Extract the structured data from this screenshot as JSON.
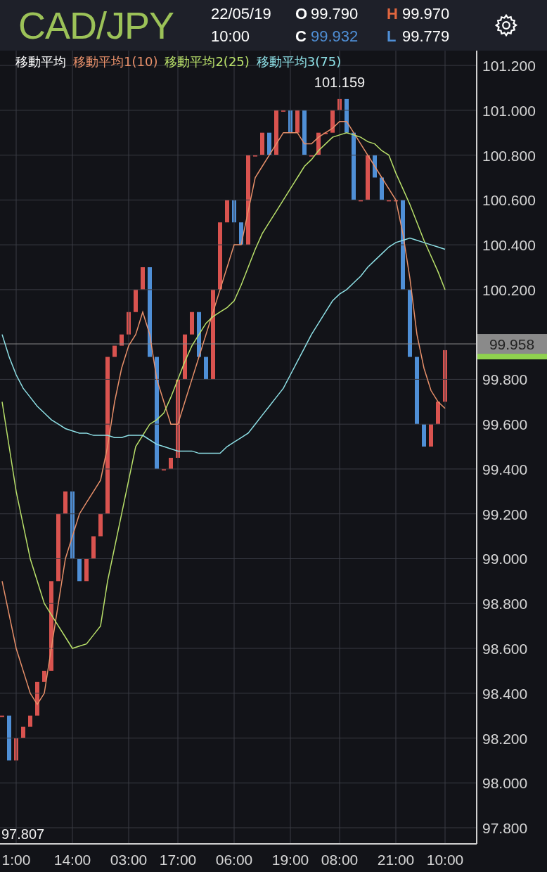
{
  "header": {
    "symbol": "CAD/JPY",
    "date": "22/05/19",
    "time": "10:00",
    "ohlc": [
      {
        "label": {
          "text": "O",
          "color": "#ffffff"
        },
        "value": {
          "text": "99.790",
          "color": "#ffffff"
        }
      },
      {
        "label": {
          "text": "H",
          "color": "#e0663f"
        },
        "value": {
          "text": "99.970",
          "color": "#ffffff"
        }
      },
      {
        "label": {
          "text": "C",
          "color": "#ffffff"
        },
        "value": {
          "text": "99.932",
          "color": "#4f8fd6"
        }
      },
      {
        "label": {
          "text": "L",
          "color": "#4f8fd6"
        },
        "value": {
          "text": "99.779",
          "color": "#ffffff"
        }
      }
    ]
  },
  "legend": {
    "title": "移動平均"
  },
  "chart": {
    "chart_data": {
      "type": "line",
      "grid": true,
      "ref_lines": [
        {
          "axis": "y",
          "value": 99.958,
          "label": "99.958"
        }
      ],
      "categories": [
        null,
        null,
        "1:00",
        null,
        null,
        null,
        null,
        null,
        null,
        null,
        "14:00",
        null,
        null,
        null,
        null,
        null,
        null,
        null,
        "03:00",
        null,
        null,
        null,
        null,
        null,
        null,
        "17:00",
        null,
        null,
        null,
        null,
        null,
        null,
        null,
        "06:00",
        null,
        null,
        null,
        null,
        null,
        null,
        null,
        "19:00",
        null,
        null,
        null,
        null,
        null,
        null,
        "08:00",
        null,
        null,
        null,
        null,
        null,
        null,
        null,
        "21:00",
        null,
        null,
        null,
        null,
        null,
        null,
        "10:00"
      ],
      "ylim": [
        97.728,
        101.266
      ],
      "yticks": [
        {
          "value": 97.8,
          "label": "97.800"
        },
        {
          "value": 98.0,
          "label": "98.000"
        },
        {
          "value": 98.2,
          "label": "98.200"
        },
        {
          "value": 98.4,
          "label": "98.400"
        },
        {
          "value": 98.6,
          "label": "98.600"
        },
        {
          "value": 98.8,
          "label": "98.800"
        },
        {
          "value": 99.0,
          "label": "99.000"
        },
        {
          "value": 99.2,
          "label": "99.200"
        },
        {
          "value": 99.4,
          "label": "99.400"
        },
        {
          "value": 99.6,
          "label": "99.600"
        },
        {
          "value": 99.8,
          "label": "99.800"
        },
        {
          "value": 100.2,
          "label": "100.200"
        },
        {
          "value": 100.4,
          "label": "100.400"
        },
        {
          "value": 100.6,
          "label": "100.600"
        },
        {
          "value": 100.8,
          "label": "100.800"
        },
        {
          "value": 101.0,
          "label": "101.000"
        },
        {
          "value": 101.2,
          "label": "101.200"
        }
      ],
      "series": [
        {
          "name": "移動平均1(10)",
          "color": "#e8906a",
          "values": [
            98.9,
            98.75,
            98.6,
            98.5,
            98.4,
            98.35,
            98.4,
            98.6,
            98.8,
            99.0,
            99.1,
            99.2,
            99.25,
            99.3,
            99.35,
            99.5,
            99.7,
            99.85,
            99.95,
            100.0,
            100.1,
            100.0,
            99.8,
            99.7,
            99.6,
            99.6,
            99.7,
            99.8,
            99.9,
            100.0,
            100.1,
            100.2,
            100.3,
            100.4,
            100.4,
            100.55,
            100.7,
            100.75,
            100.8,
            100.85,
            100.9,
            100.9,
            100.9,
            100.85,
            100.85,
            100.88,
            100.9,
            100.92,
            100.95,
            100.95,
            100.9,
            100.85,
            100.8,
            100.75,
            100.7,
            100.65,
            100.6,
            100.45,
            100.25,
            100.0,
            99.85,
            99.75,
            99.7,
            99.67
          ]
        },
        {
          "name": "移動平均2(25)",
          "color": "#b9e06a",
          "values": [
            99.7,
            99.5,
            99.3,
            99.15,
            99.0,
            98.9,
            98.8,
            98.75,
            98.7,
            98.65,
            98.6,
            98.61,
            98.62,
            98.66,
            98.7,
            98.9,
            99.05,
            99.2,
            99.35,
            99.5,
            99.55,
            99.6,
            99.62,
            99.65,
            99.72,
            99.8,
            99.88,
            99.95,
            100.0,
            100.05,
            100.08,
            100.1,
            100.12,
            100.15,
            100.22,
            100.3,
            100.38,
            100.45,
            100.5,
            100.55,
            100.6,
            100.65,
            100.7,
            100.75,
            100.78,
            100.82,
            100.85,
            100.88,
            100.89,
            100.9,
            100.89,
            100.88,
            100.86,
            100.85,
            100.82,
            100.8,
            100.72,
            100.65,
            100.58,
            100.5,
            100.42,
            100.35,
            100.28,
            100.2
          ]
        },
        {
          "name": "移動平均3(75)",
          "color": "#8ee0e6",
          "values": [
            100.0,
            99.9,
            99.82,
            99.76,
            99.72,
            99.68,
            99.65,
            99.62,
            99.6,
            99.58,
            99.57,
            99.56,
            99.56,
            99.55,
            99.55,
            99.55,
            99.54,
            99.54,
            99.55,
            99.55,
            99.55,
            99.53,
            99.51,
            99.5,
            99.49,
            99.48,
            99.48,
            99.48,
            99.47,
            99.47,
            99.47,
            99.47,
            99.5,
            99.52,
            99.54,
            99.56,
            99.6,
            99.64,
            99.68,
            99.72,
            99.76,
            99.82,
            99.88,
            99.94,
            100.0,
            100.05,
            100.1,
            100.15,
            100.18,
            100.2,
            100.23,
            100.26,
            100.3,
            100.33,
            100.36,
            100.39,
            100.41,
            100.42,
            100.43,
            100.42,
            100.41,
            100.4,
            100.39,
            100.38
          ]
        }
      ],
      "annotations": [
        "101.159",
        "97.807"
      ]
    }
  }
}
